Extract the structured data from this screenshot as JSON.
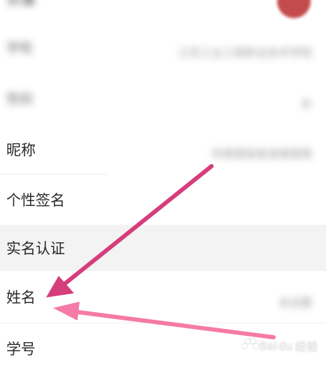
{
  "profile": {
    "rows": [
      {
        "label": "头像",
        "value": ""
      },
      {
        "label": "学校",
        "value": "江苏工业工程职业技术学院"
      },
      {
        "label": "性别",
        "value": "女"
      },
      {
        "label": "昵称",
        "value": "你猜猜我是谁猜猜猜"
      },
      {
        "label": "个性签名",
        "value": ""
      },
      {
        "label": "实名认证",
        "value": ""
      },
      {
        "label": "姓名",
        "value": "未设置"
      },
      {
        "label": "学号",
        "value": ""
      }
    ]
  },
  "annotation": {
    "arrow_color_primary": "#d63d7c",
    "arrow_color_secondary": "#f57aa6"
  },
  "watermark": {
    "brand": "Bai",
    "brand_suffix": "du",
    "product": "经验"
  }
}
